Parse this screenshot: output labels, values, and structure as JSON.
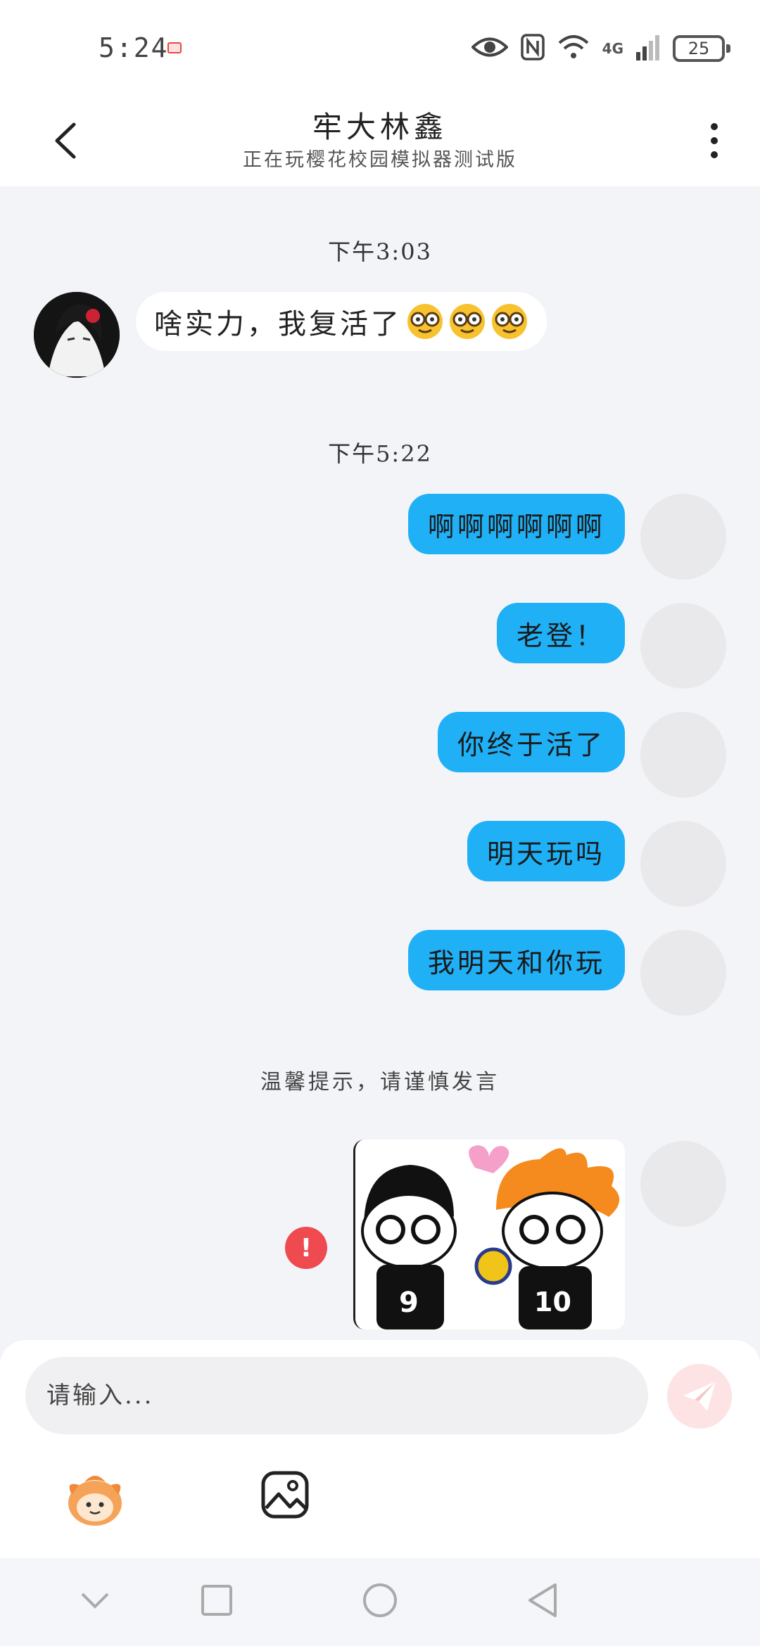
{
  "status_bar": {
    "time": "5:24",
    "network": "4G",
    "battery": "25"
  },
  "header": {
    "title": "牢大林鑫",
    "subtitle": "正在玩樱花校园模拟器测试版"
  },
  "chat": {
    "timestamp_1": "下午3:03",
    "incoming_message": "啥实力，我复活了",
    "timestamp_2": "下午5:22",
    "outgoing_messages": [
      "啊啊啊啊啊啊",
      "老登！",
      "你终于活了",
      "明天玩吗",
      "我明天和你玩"
    ],
    "tip": "温馨提示，请谨慎发言",
    "failed_icon_glyph": "!"
  },
  "input": {
    "placeholder": "请输入..."
  },
  "colors": {
    "outgoing_bubble": "#1fb0f6",
    "background": "#f2f4f8",
    "error": "#ee4a4f",
    "send_button": "#fde3e3"
  },
  "icons": {
    "back": "chevron-left-icon",
    "more": "vertical-dots-icon",
    "send": "paper-plane-icon",
    "sticker": "mascot-sticker-icon",
    "image": "picture-icon",
    "nav": [
      "chevron-down-icon",
      "square-icon",
      "circle-icon",
      "triangle-back-icon"
    ]
  }
}
